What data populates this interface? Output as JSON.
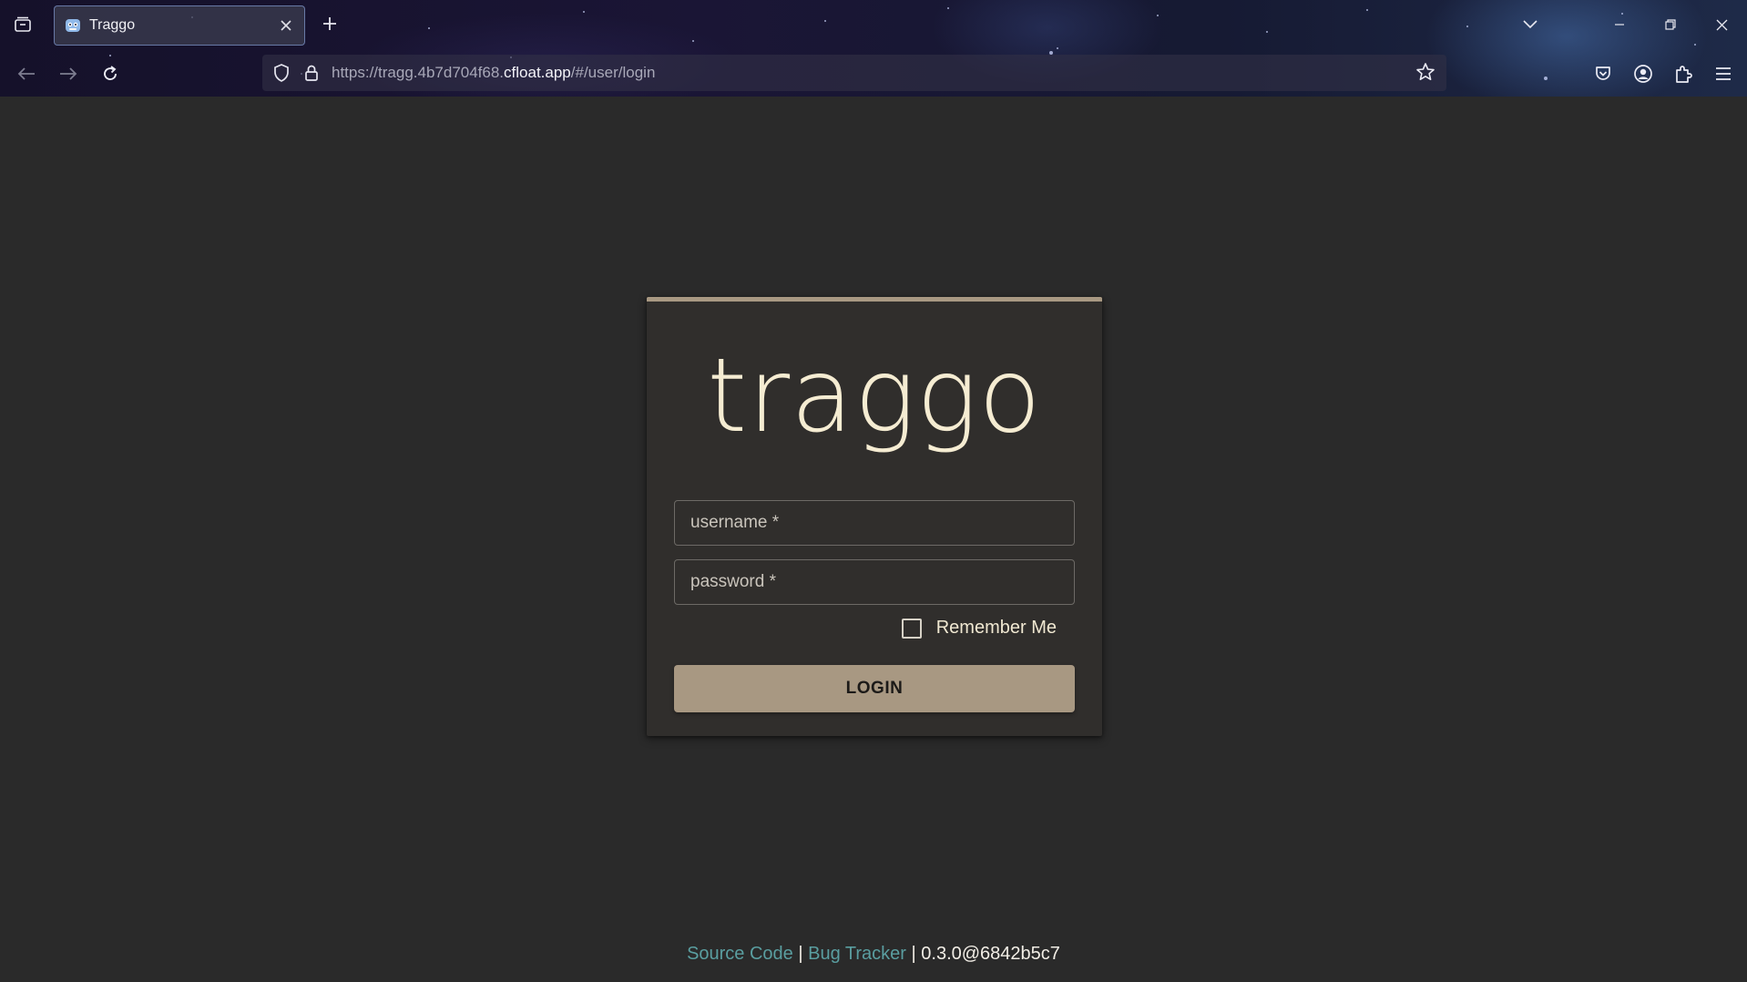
{
  "browser": {
    "tab": {
      "title": "Traggo"
    },
    "url": {
      "prefix": "https://tragg.4b7d704f68.",
      "host": "cfloat.app",
      "suffix": "/#/user/login"
    }
  },
  "login": {
    "logo": "traggo",
    "username_placeholder": "username *",
    "password_placeholder": "password *",
    "remember_label": "Remember Me",
    "remember_checked": false,
    "login_button": "LOGIN"
  },
  "footer": {
    "source_code": "Source Code",
    "separator": " | ",
    "bug_tracker": "Bug Tracker",
    "version": "0.3.0@6842b5c7"
  },
  "colors": {
    "accent": "#a89882",
    "logo": "#f5ecd2",
    "link": "#5a9ea0",
    "background": "#2a2a2a",
    "card": "#302e2c"
  }
}
